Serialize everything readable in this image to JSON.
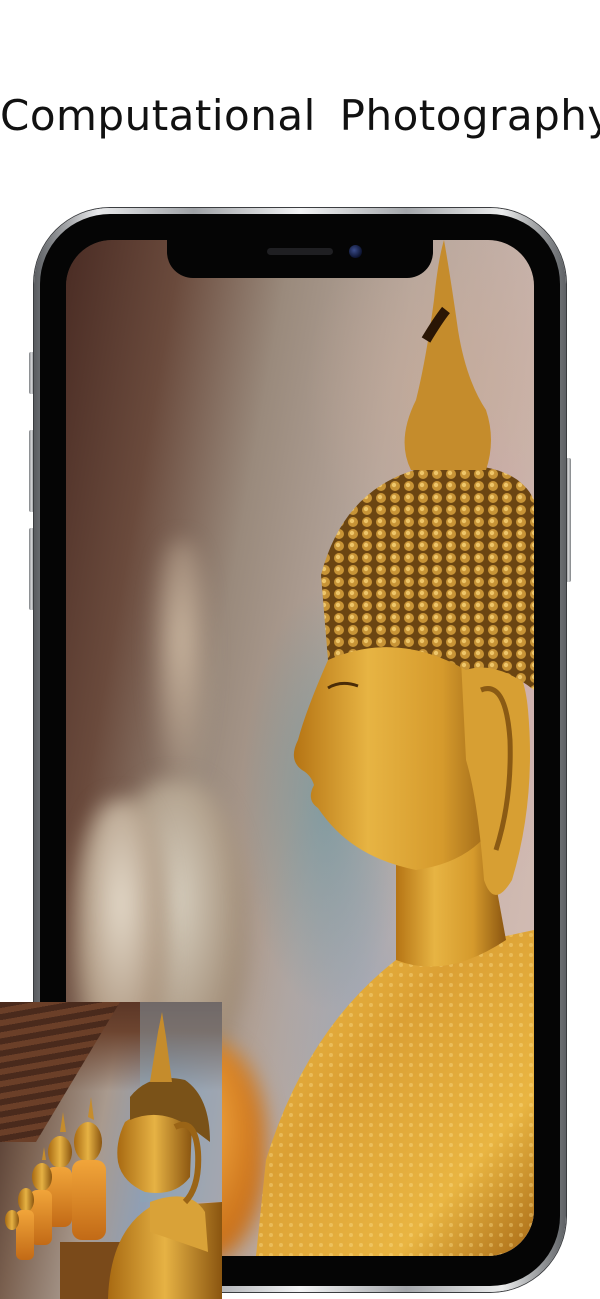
{
  "headline": "Computational Photography",
  "colors": {
    "background": "#ffffff",
    "headline_text": "#111111",
    "phone_frame": "#a4a7ab",
    "gold": "#d9a23a"
  },
  "icons": {
    "camera": "front-camera-icon"
  }
}
